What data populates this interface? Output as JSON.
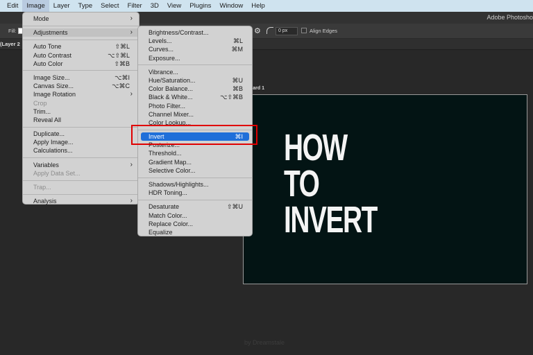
{
  "menubar": {
    "items": [
      {
        "label": "Edit",
        "active": false
      },
      {
        "label": "Image",
        "active": true
      },
      {
        "label": "Layer",
        "active": false
      },
      {
        "label": "Type",
        "active": false
      },
      {
        "label": "Select",
        "active": false
      },
      {
        "label": "Filter",
        "active": false
      },
      {
        "label": "3D",
        "active": false
      },
      {
        "label": "View",
        "active": false
      },
      {
        "label": "Plugins",
        "active": false
      },
      {
        "label": "Window",
        "active": false
      },
      {
        "label": "Help",
        "active": false
      }
    ]
  },
  "app": {
    "title": "Adobe Photosho"
  },
  "options_bar": {
    "fill_label": "Fill:",
    "radius_value": "0 px",
    "align_edges_label": "Align Edges"
  },
  "document": {
    "tab_label": "(Layer 2"
  },
  "canvas": {
    "artboard_label": "oard 1",
    "headline_lines": [
      "HOW",
      "TO",
      "INVERT"
    ],
    "watermark": "by Dreamstale"
  },
  "image_menu": {
    "items": [
      {
        "label": "Mode",
        "submenu": true
      },
      {
        "sep": true
      },
      {
        "label": "Adjustments",
        "submenu": true,
        "highlighted": true
      },
      {
        "sep": true
      },
      {
        "label": "Auto Tone",
        "shortcut": "⇧⌘L"
      },
      {
        "label": "Auto Contrast",
        "shortcut": "⌥⇧⌘L"
      },
      {
        "label": "Auto Color",
        "shortcut": "⇧⌘B"
      },
      {
        "sep": true
      },
      {
        "label": "Image Size...",
        "shortcut": "⌥⌘I"
      },
      {
        "label": "Canvas Size...",
        "shortcut": "⌥⌘C"
      },
      {
        "label": "Image Rotation",
        "submenu": true
      },
      {
        "label": "Crop",
        "disabled": true
      },
      {
        "label": "Trim..."
      },
      {
        "label": "Reveal All"
      },
      {
        "sep": true
      },
      {
        "label": "Duplicate..."
      },
      {
        "label": "Apply Image..."
      },
      {
        "label": "Calculations..."
      },
      {
        "sep": true
      },
      {
        "label": "Variables",
        "submenu": true
      },
      {
        "label": "Apply Data Set...",
        "disabled": true
      },
      {
        "sep": true
      },
      {
        "label": "Trap...",
        "disabled": true
      },
      {
        "sep": true
      },
      {
        "label": "Analysis",
        "submenu": true
      }
    ]
  },
  "adjustments_menu": {
    "items": [
      {
        "label": "Brightness/Contrast..."
      },
      {
        "label": "Levels...",
        "shortcut": "⌘L"
      },
      {
        "label": "Curves...",
        "shortcut": "⌘M"
      },
      {
        "label": "Exposure..."
      },
      {
        "sep": true
      },
      {
        "label": "Vibrance..."
      },
      {
        "label": "Hue/Saturation...",
        "shortcut": "⌘U"
      },
      {
        "label": "Color Balance...",
        "shortcut": "⌘B"
      },
      {
        "label": "Black & White...",
        "shortcut": "⌥⇧⌘B"
      },
      {
        "label": "Photo Filter..."
      },
      {
        "label": "Channel Mixer..."
      },
      {
        "label": "Color Lookup..."
      },
      {
        "sep": true
      },
      {
        "label": "Invert",
        "shortcut": "⌘I",
        "selected": true
      },
      {
        "label": "Posterize..."
      },
      {
        "label": "Threshold..."
      },
      {
        "label": "Gradient Map..."
      },
      {
        "label": "Selective Color..."
      },
      {
        "sep": true
      },
      {
        "label": "Shadows/Highlights..."
      },
      {
        "label": "HDR Toning..."
      },
      {
        "sep": true
      },
      {
        "label": "Desaturate",
        "shortcut": "⇧⌘U"
      },
      {
        "label": "Match Color..."
      },
      {
        "label": "Replace Color..."
      },
      {
        "label": "Equalize"
      }
    ]
  },
  "colors": {
    "menubar_bg": "#cfe3ef",
    "selection": "#1f6fd9",
    "callout": "#e00000",
    "artboard_bg": "#031414"
  }
}
